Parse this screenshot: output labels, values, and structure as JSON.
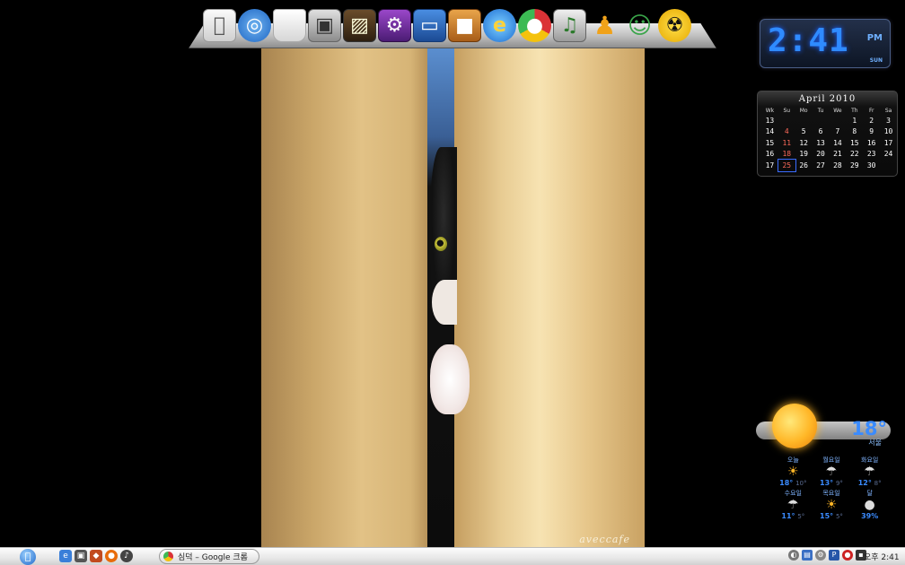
{
  "dock": {
    "icons": [
      {
        "name": "finder",
        "glyph": ""
      },
      {
        "name": "safari",
        "glyph": "◎"
      },
      {
        "name": "trash",
        "glyph": ""
      },
      {
        "name": "disk-utility",
        "glyph": "▣"
      },
      {
        "name": "photo",
        "glyph": "▨"
      },
      {
        "name": "purple-app",
        "glyph": "⚙"
      },
      {
        "name": "window-app",
        "glyph": "▭"
      },
      {
        "name": "box-app",
        "glyph": "■"
      },
      {
        "name": "internet-explorer",
        "glyph": "e"
      },
      {
        "name": "chrome",
        "glyph": "●"
      },
      {
        "name": "itunes",
        "glyph": "♫"
      },
      {
        "name": "aim",
        "glyph": "♟"
      },
      {
        "name": "msn-messenger",
        "glyph": "☺"
      },
      {
        "name": "radiation",
        "glyph": "☢"
      }
    ]
  },
  "clock": {
    "time": "2:41",
    "ampm": "PM",
    "day": "SUN"
  },
  "calendar": {
    "title": "April 2010",
    "headers": [
      "Wk",
      "Su",
      "Mo",
      "Tu",
      "We",
      "Th",
      "Fr",
      "Sa"
    ],
    "rows": [
      [
        "13",
        "",
        "",
        "",
        "",
        "1",
        "2",
        "3"
      ],
      [
        "14",
        "4",
        "5",
        "6",
        "7",
        "8",
        "9",
        "10"
      ],
      [
        "15",
        "11",
        "12",
        "13",
        "14",
        "15",
        "16",
        "17"
      ],
      [
        "16",
        "18",
        "19",
        "20",
        "21",
        "22",
        "23",
        "24"
      ],
      [
        "17",
        "25",
        "26",
        "27",
        "28",
        "29",
        "30",
        ""
      ]
    ],
    "today": "25"
  },
  "weather": {
    "temp": "18°",
    "city": "서울",
    "forecast": [
      {
        "day": "오늘",
        "icon": "partly-sunny",
        "hi": "18°",
        "lo": "10°"
      },
      {
        "day": "월요일",
        "icon": "rain",
        "hi": "13°",
        "lo": "9°"
      },
      {
        "day": "화요일",
        "icon": "rain",
        "hi": "12°",
        "lo": "8°"
      },
      {
        "day": "수요일",
        "icon": "rain",
        "hi": "11°",
        "lo": "5°"
      },
      {
        "day": "목요일",
        "icon": "partly-sunny",
        "hi": "15°",
        "lo": "5°"
      },
      {
        "day": "달",
        "icon": "moon",
        "hi": "39%",
        "lo": ""
      }
    ]
  },
  "wallpaper": {
    "signature": "aveccafe"
  },
  "taskbar": {
    "start_glyph": "",
    "quicklaunch": [
      "ie",
      "app-dark",
      "game",
      "firefox",
      "media"
    ],
    "task_label": "심덕 – Google 크롬",
    "tray_icons": [
      "speaker",
      "network",
      "settings",
      "shield",
      "antivirus",
      "terminal"
    ],
    "clock": "오후 2:41"
  }
}
